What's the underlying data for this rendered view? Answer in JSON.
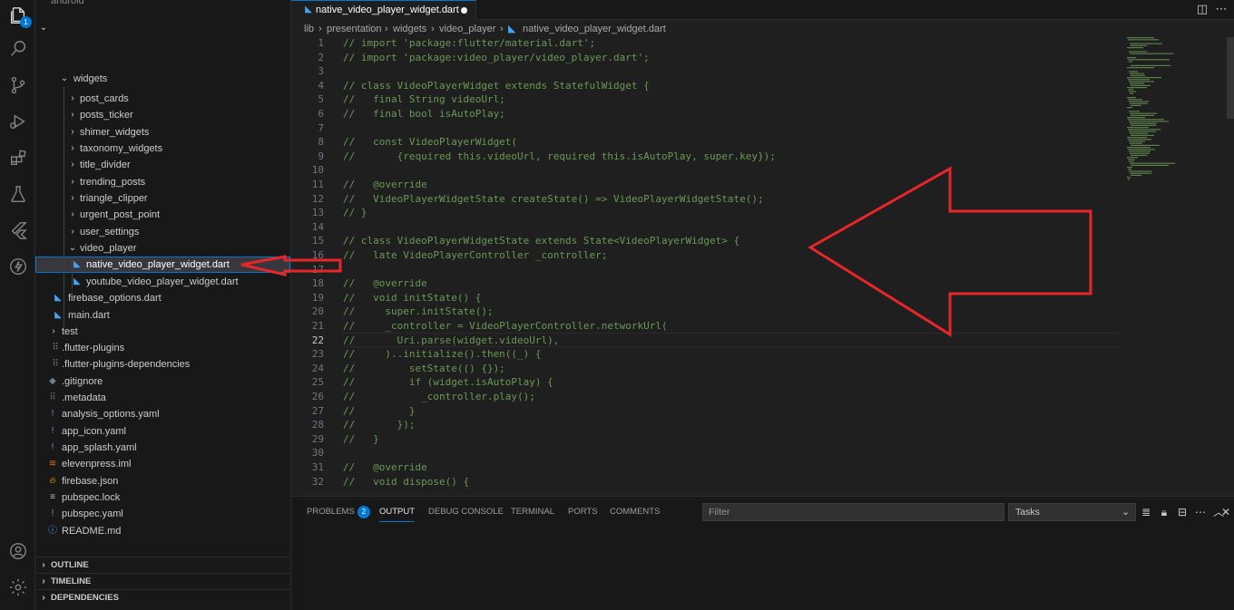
{
  "activity_bar": {
    "explorer_badge": "1",
    "items": [
      "explorer",
      "search",
      "source-control",
      "run-debug",
      "extensions",
      "testing",
      "flutter",
      "lightning"
    ]
  },
  "sidebar": {
    "top_partial_text": "android",
    "tree": [
      {
        "label": "widgets",
        "type": "folder-open"
      },
      {
        "label": "post_cards",
        "type": "folder"
      },
      {
        "label": "posts_ticker",
        "type": "folder"
      },
      {
        "label": "shimer_widgets",
        "type": "folder"
      },
      {
        "label": "taxonomy_widgets",
        "type": "folder"
      },
      {
        "label": "title_divider",
        "type": "folder"
      },
      {
        "label": "trending_posts",
        "type": "folder"
      },
      {
        "label": "triangle_clipper",
        "type": "folder"
      },
      {
        "label": "urgent_post_point",
        "type": "folder"
      },
      {
        "label": "user_settings",
        "type": "folder"
      },
      {
        "label": "video_player",
        "type": "folder-open"
      },
      {
        "label": "native_video_player_widget.dart",
        "type": "dart"
      },
      {
        "label": "youtube_video_player_widget.dart",
        "type": "dart"
      },
      {
        "label": "firebase_options.dart",
        "type": "dart"
      },
      {
        "label": "main.dart",
        "type": "dart"
      },
      {
        "label": "test",
        "type": "folder"
      },
      {
        "label": ".flutter-plugins",
        "type": "file"
      },
      {
        "label": ".flutter-plugins-dependencies",
        "type": "file"
      },
      {
        "label": ".gitignore",
        "type": "git"
      },
      {
        "label": ".metadata",
        "type": "file"
      },
      {
        "label": "analysis_options.yaml",
        "type": "yaml"
      },
      {
        "label": "app_icon.yaml",
        "type": "yaml"
      },
      {
        "label": "app_splash.yaml",
        "type": "yaml"
      },
      {
        "label": "elevenpress.iml",
        "type": "iml"
      },
      {
        "label": "firebase.json",
        "type": "firebase"
      },
      {
        "label": "pubspec.lock",
        "type": "lock"
      },
      {
        "label": "pubspec.yaml",
        "type": "yaml"
      },
      {
        "label": "README.md",
        "type": "md"
      }
    ],
    "sections": [
      "OUTLINE",
      "TIMELINE",
      "DEPENDENCIES"
    ]
  },
  "tab": {
    "label": "native_video_player_widget.dart"
  },
  "breadcrumb": [
    "lib",
    "presentation",
    "widgets",
    "video_player",
    "native_video_player_widget.dart"
  ],
  "editor": {
    "active_line": 22,
    "lines": [
      {
        "n": "1",
        "text": "// import 'package:flutter/material.dart';"
      },
      {
        "n": "2",
        "text": "// import 'package:video_player/video_player.dart';"
      },
      {
        "n": "3",
        "text": ""
      },
      {
        "n": "4",
        "text": "// class VideoPlayerWidget extends StatefulWidget {"
      },
      {
        "n": "5",
        "text": "//   final String videoUrl;"
      },
      {
        "n": "6",
        "text": "//   final bool isAutoPlay;"
      },
      {
        "n": "7",
        "text": ""
      },
      {
        "n": "8",
        "text": "//   const VideoPlayerWidget("
      },
      {
        "n": "9",
        "text": "//       {required this.videoUrl, required this.isAutoPlay, super.key});"
      },
      {
        "n": "10",
        "text": ""
      },
      {
        "n": "11",
        "text": "//   @override"
      },
      {
        "n": "12",
        "text": "//   VideoPlayerWidgetState createState() => VideoPlayerWidgetState();"
      },
      {
        "n": "13",
        "text": "// }"
      },
      {
        "n": "14",
        "text": ""
      },
      {
        "n": "15",
        "text": "// class VideoPlayerWidgetState extends State<VideoPlayerWidget> {"
      },
      {
        "n": "16",
        "text": "//   late VideoPlayerController _controller;"
      },
      {
        "n": "17",
        "text": ""
      },
      {
        "n": "18",
        "text": "//   @override"
      },
      {
        "n": "19",
        "text": "//   void initState() {"
      },
      {
        "n": "20",
        "text": "//     super.initState();"
      },
      {
        "n": "21",
        "text": "//     _controller = VideoPlayerController.networkUrl("
      },
      {
        "n": "22",
        "text": "//       Uri.parse(widget.videoUrl),"
      },
      {
        "n": "23",
        "text": "//     )..initialize().then((_) {"
      },
      {
        "n": "24",
        "text": "//         setState(() {});"
      },
      {
        "n": "25",
        "text": "//         if (widget.isAutoPlay) {"
      },
      {
        "n": "26",
        "text": "//           _controller.play();"
      },
      {
        "n": "27",
        "text": "//         }"
      },
      {
        "n": "28",
        "text": "//       });"
      },
      {
        "n": "29",
        "text": "//   }"
      },
      {
        "n": "30",
        "text": ""
      },
      {
        "n": "31",
        "text": "//   @override"
      },
      {
        "n": "32",
        "text": "//   void dispose() {"
      }
    ]
  },
  "panel": {
    "tabs": [
      {
        "label": "PROBLEMS",
        "badge": "2"
      },
      {
        "label": "OUTPUT"
      },
      {
        "label": "DEBUG CONSOLE"
      },
      {
        "label": "TERMINAL"
      },
      {
        "label": "PORTS"
      },
      {
        "label": "COMMENTS"
      }
    ],
    "active_tab": "OUTPUT",
    "filter_placeholder": "Filter",
    "tasks_value": "Tasks"
  },
  "colors": {
    "accent": "#0078d4",
    "comment": "#6a9955",
    "annotation_arrow": "#e8262a",
    "dart_icon": "#42a5f5",
    "yaml_icon": "#a074c4",
    "git_icon": "#6d8086",
    "firebase_icon": "#ffa000",
    "iml_icon": "#f16529"
  }
}
